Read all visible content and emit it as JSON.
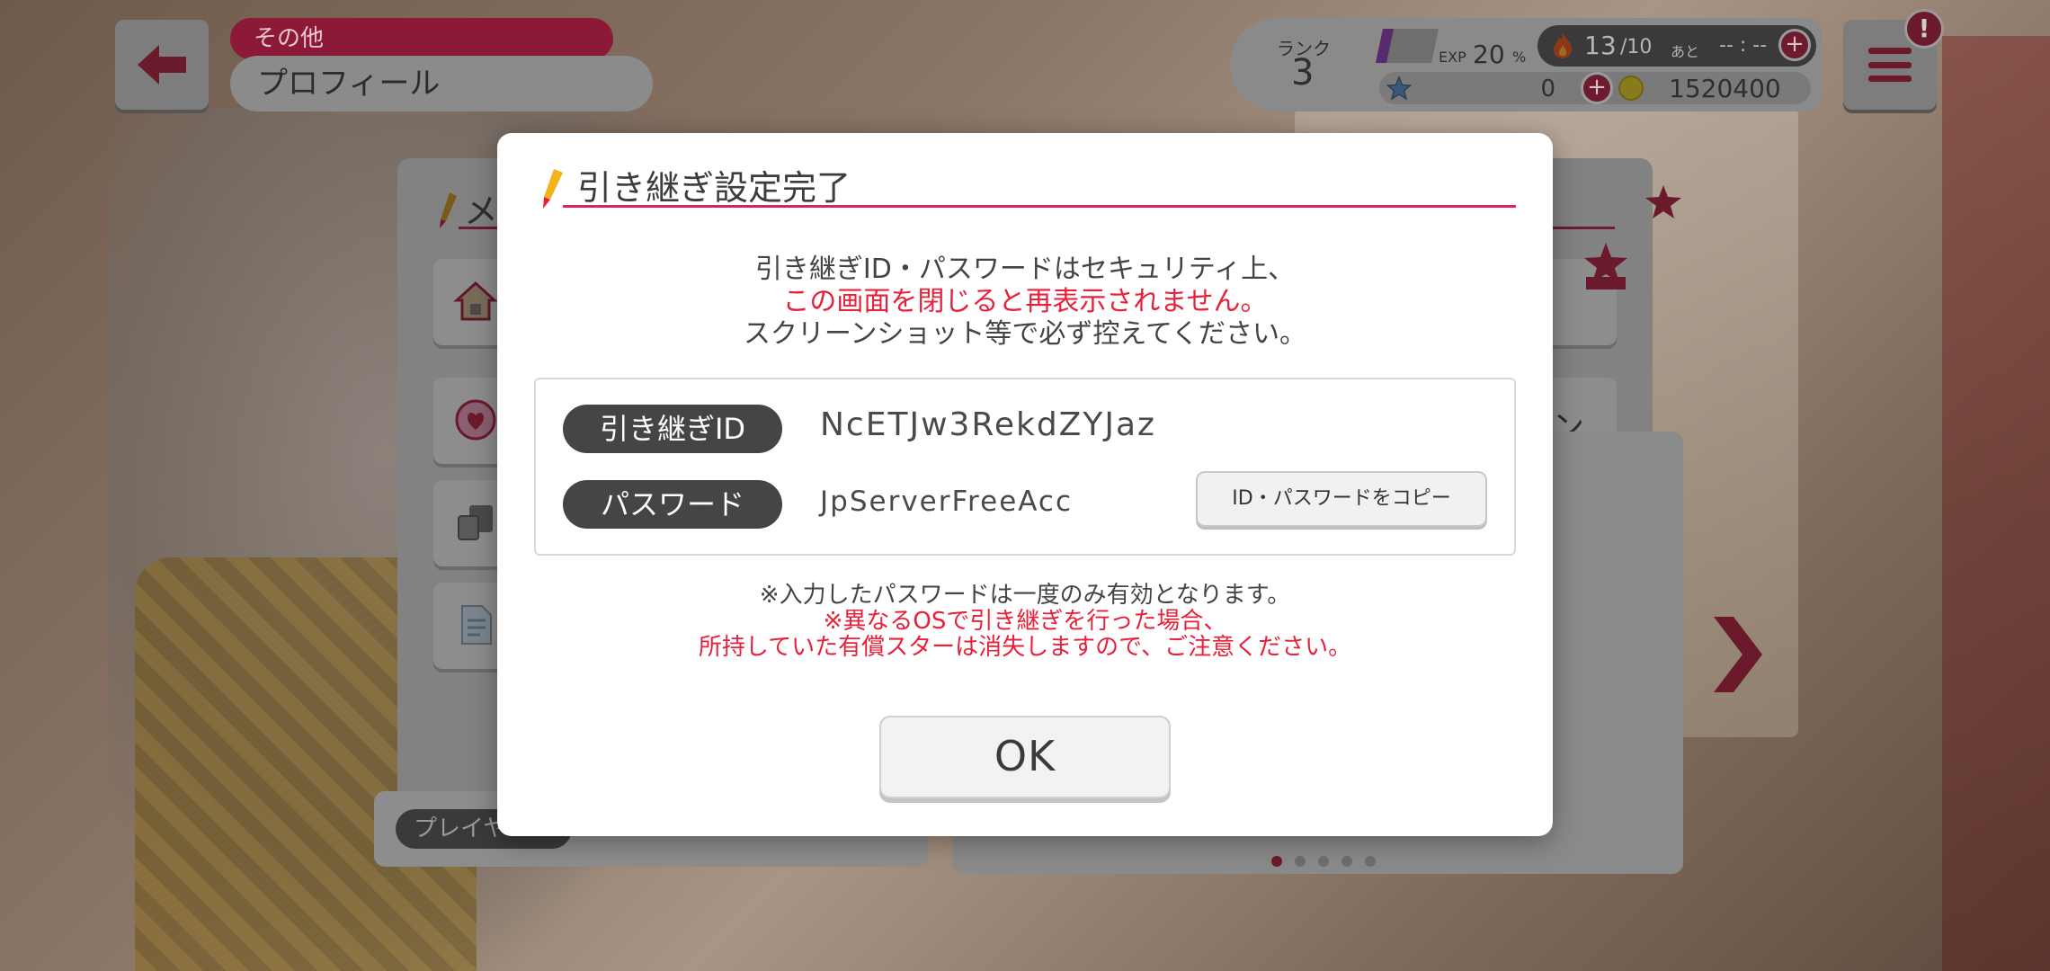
{
  "header": {
    "category": "その他",
    "title": "プロフィール"
  },
  "status": {
    "rank_label": "ランク",
    "rank_value": "3",
    "exp_label": "EXP",
    "exp_value": "20",
    "exp_unit": "%",
    "exp_progress": 0.2,
    "lp_current": "13",
    "lp_max": "/10",
    "lp_ato": "あと",
    "lp_time": "-- : --",
    "gems": "0",
    "coins": "1520400",
    "plus": "+",
    "alert": "!"
  },
  "underlying": {
    "title_partial": "メ",
    "item_right_partial": "ン",
    "player_label": "プレイヤー"
  },
  "modal": {
    "title": "引き継ぎ設定完了",
    "notice_line1": "引き継ぎID・パスワードはセキュリティ上、",
    "notice_line2": "この画面を閉じると再表示されません。",
    "notice_line3": "スクリーンショット等で必ず控えてください。",
    "id_label": "引き継ぎID",
    "id_value": "NcETJw3RekdZYJaz",
    "password_label": "パスワード",
    "password_value": "JpServerFreeAcc",
    "copy_button": "ID・パスワードをコピー",
    "note_line1": "※入力したパスワードは一度のみ有効となります。",
    "note_line2": "※異なるOSで引き継ぎを行った場合、",
    "note_line3": "所持していた有償スターは消失しますので、ご注意ください。",
    "ok_button": "OK"
  },
  "colors": {
    "accent_red": "#e8213b",
    "title_line": "#d8245a",
    "pill_dark": "#454545"
  }
}
